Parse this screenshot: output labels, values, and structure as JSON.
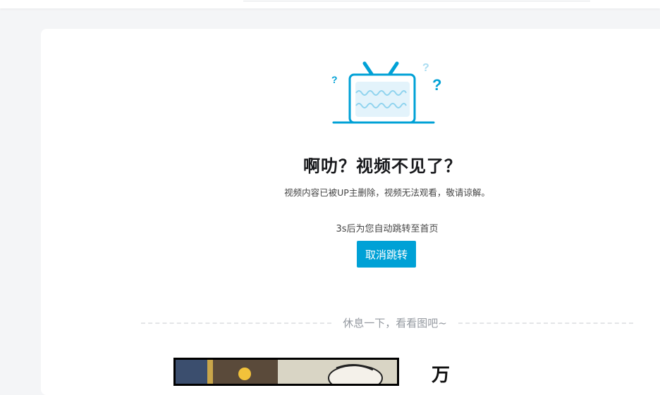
{
  "page": {
    "title": "啊叻？视频不见了？",
    "description": "视频内容已被UP主删除，视频无法观看，敬请谅解。",
    "countdown_text": "3s后为您自动跳转至首页",
    "cancel_button_label": "取消跳转",
    "divider_text": "休息一下，看看图吧~",
    "comic_glyph": "万"
  },
  "colors": {
    "accent": "#00a1d6",
    "tv_blue": "#00a1d6",
    "tv_screen": "#e6f4fb",
    "page_bg": "#f4f5f7",
    "muted_text": "#9499a0"
  },
  "icons": {
    "tv": "tv-error-icon",
    "question": "question-mark-icon"
  }
}
